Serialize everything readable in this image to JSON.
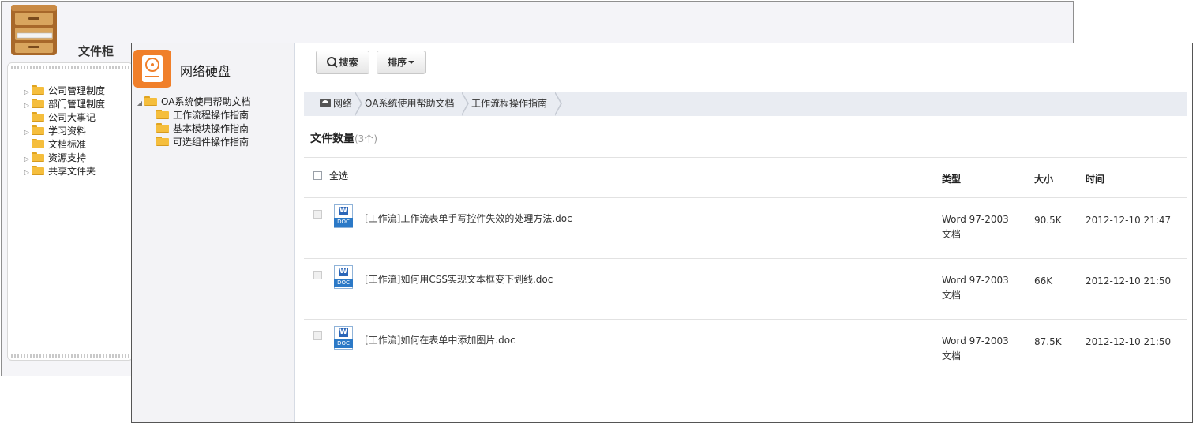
{
  "cabinet": {
    "title": "文件柜",
    "tree": [
      {
        "label": "公司管理制度",
        "expandable": true
      },
      {
        "label": "部门管理制度",
        "expandable": true
      },
      {
        "label": "公司大事记",
        "expandable": false
      },
      {
        "label": "学习资料",
        "expandable": true
      },
      {
        "label": "文档标准",
        "expandable": false
      },
      {
        "label": "资源支持",
        "expandable": true
      },
      {
        "label": "共享文件夹",
        "expandable": true
      }
    ]
  },
  "netdisk": {
    "title": "网络硬盘",
    "tree": {
      "root": "OA系统使用帮助文档",
      "children": [
        "工作流程操作指南",
        "基本模块操作指南",
        "可选组件操作指南"
      ]
    },
    "toolbar": {
      "search_label": "搜索",
      "sort_label": "排序"
    },
    "breadcrumb": [
      "网络",
      "OA系统使用帮助文档",
      "工作流程操作指南"
    ],
    "file_count_label": "文件数量",
    "file_count_value": "(3个)",
    "table": {
      "select_all": "全选",
      "columns": {
        "type": "类型",
        "size": "大小",
        "time": "时间"
      },
      "rows": [
        {
          "name": "[工作流]工作流表单手写控件失效的处理方法.doc",
          "type": "Word 97-2003 文档",
          "size": "90.5K",
          "time": "2012-12-10 21:47"
        },
        {
          "name": "[工作流]如何用CSS实现文本框变下划线.doc",
          "type": "Word 97-2003 文档",
          "size": "66K",
          "time": "2012-12-10 21:50"
        },
        {
          "name": "[工作流]如何在表单中添加图片.doc",
          "type": "Word 97-2003 文档",
          "size": "87.5K",
          "time": "2012-12-10 21:50"
        }
      ]
    },
    "doc_icon": {
      "letter": "W",
      "tag": "DOC"
    }
  }
}
